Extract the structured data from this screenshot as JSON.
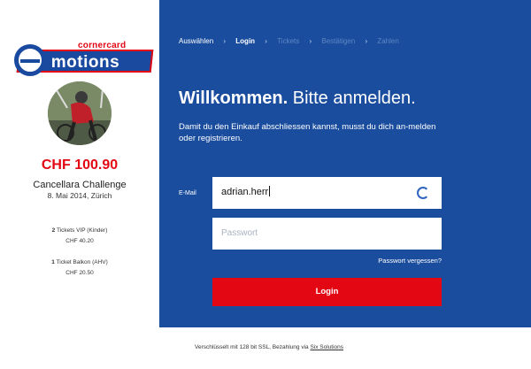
{
  "brand": {
    "logo_small": "cornercard",
    "logo_main": "motions"
  },
  "order": {
    "price": "CHF 100.90",
    "event_name": "Cancellara Challenge",
    "event_date": "8. Mai 2014, Zürich",
    "tickets": [
      {
        "qty": "2",
        "label": "Tickets VIP (Kinder)",
        "price": "CHF 40.20"
      },
      {
        "qty": "1",
        "label": "Ticket Balkon (AHV)",
        "price": "CHF 20.50"
      }
    ]
  },
  "steps": {
    "s1": "Auswählen",
    "s2": "Login",
    "s3": "Tickets",
    "s4": "Bestätigen",
    "s5": "Zahlen",
    "separator": "›"
  },
  "login": {
    "welcome_bold": "Willkommen.",
    "welcome_rest": " Bitte anmelden.",
    "intro": "Damit du den Einkauf abschliessen kannst, musst du dich an-melden oder registrieren.",
    "email_label": "E-Mail",
    "email_value": "adrian.herr",
    "password_placeholder": "Passwort",
    "forgot": "Passwort vergessen?",
    "button": "Login"
  },
  "footer": {
    "text": "Verschlüsselt mit 128 bit SSL, Bezahlung via ",
    "link": "Six Solutions"
  },
  "colors": {
    "brand_blue": "#1a4d9e",
    "accent_red": "#e30613"
  }
}
